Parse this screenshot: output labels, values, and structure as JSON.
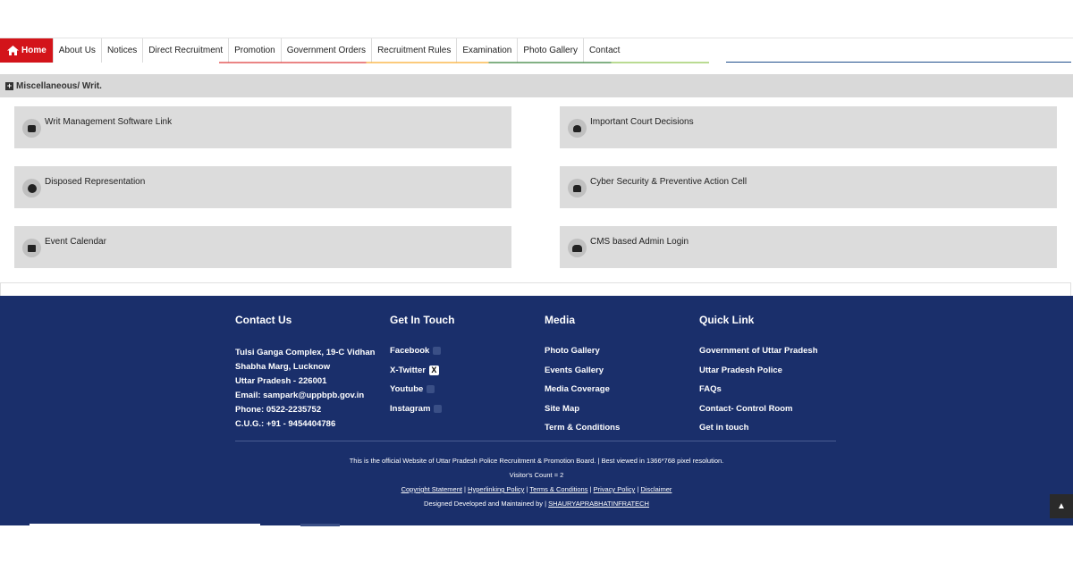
{
  "nav": {
    "items": [
      {
        "label": "Home",
        "icon": "home-icon"
      },
      {
        "label": "About Us"
      },
      {
        "label": "Notices"
      },
      {
        "label": "Direct Recruitment"
      },
      {
        "label": "Promotion"
      },
      {
        "label": "Government Orders"
      },
      {
        "label": "Recruitment Rules"
      },
      {
        "label": "Examination"
      },
      {
        "label": "Photo Gallery"
      },
      {
        "label": "Contact"
      }
    ],
    "active_color": "#d3141a"
  },
  "section": {
    "title": "Miscellaneous/ Writ."
  },
  "cards": [
    {
      "label": "Writ Management Software Link",
      "icon": "briefcase-icon"
    },
    {
      "label": "Important Court Decisions",
      "icon": "user-tie-icon"
    },
    {
      "label": "Disposed Representation",
      "icon": "gear-icon"
    },
    {
      "label": "Cyber Security & Preventive Action Cell",
      "icon": "user-secret-icon"
    },
    {
      "label": "Event Calendar",
      "icon": "calendar-icon"
    },
    {
      "label": "CMS based Admin Login",
      "icon": "user-lock-icon"
    }
  ],
  "footer": {
    "bg_color": "#1a2f6b",
    "contact": {
      "title": "Contact Us",
      "lines": [
        "Tulsi Ganga Complex, 19-C Vidhan",
        "Shabha Marg, Lucknow",
        "Uttar Pradesh - 226001",
        "Email: sampark@uppbpb.gov.in",
        "Phone: 0522-2235752",
        "C.U.G.: +91 - 9454404786"
      ]
    },
    "touch": {
      "title": "Get In Touch",
      "links": [
        "Facebook",
        "X-Twitter",
        "Youtube",
        "Instagram"
      ]
    },
    "media": {
      "title": "Media",
      "links": [
        "Photo Gallery",
        "Events Gallery",
        "Media Coverage",
        "Site Map",
        "Term & Conditions"
      ]
    },
    "quick": {
      "title": "Quick Link",
      "links": [
        "Government of Uttar Pradesh",
        "Uttar Pradesh Police",
        "FAQs",
        "Contact- Control Room",
        "Get in touch"
      ]
    },
    "official_text": "This is the official Website of Uttar Pradesh Police Recruitment & Promotion Board. | Best viewed in 1366*768 pixel resolution.",
    "visitor_count": "Visitor's Count = 2",
    "policy_links": [
      "Copyright Statement",
      "Hyperlinking Policy",
      "Terms & Conditions",
      "Privacy Policy",
      "Disclaimer"
    ],
    "designed_by": "Designed Developed and Maintained by |",
    "designer_link": "SHAURYAPRABHATINFRATECH"
  }
}
